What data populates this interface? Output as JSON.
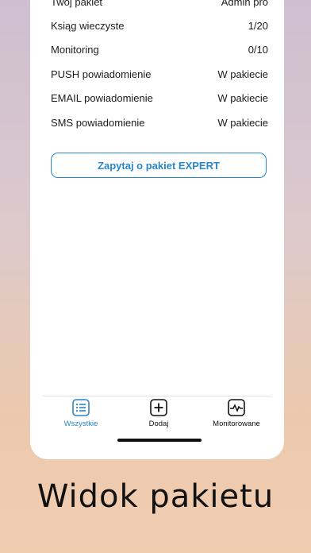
{
  "rows": [
    {
      "label": "Twój pakiet",
      "value": "Admin pro"
    },
    {
      "label": "Ksiąg wieczyste",
      "value": "1/20"
    },
    {
      "label": "Monitoring",
      "value": "0/10"
    },
    {
      "label": "PUSH powiadomienie",
      "value": "W pakiecie"
    },
    {
      "label": "EMAIL powiadomienie",
      "value": "W pakiecie"
    },
    {
      "label": "SMS powiadomienie",
      "value": "W pakiecie"
    }
  ],
  "cta_label": "Zapytaj o pakiet EXPERT",
  "tabs": [
    {
      "label": "Wszystkie",
      "icon": "list-icon",
      "active": true
    },
    {
      "label": "Dodaj",
      "icon": "plus-square-icon",
      "active": false
    },
    {
      "label": "Monitorowane",
      "icon": "monitor-pulse-icon",
      "active": false
    }
  ],
  "caption": "Widok pakietu",
  "colors": {
    "accent": "#2a86c9"
  }
}
